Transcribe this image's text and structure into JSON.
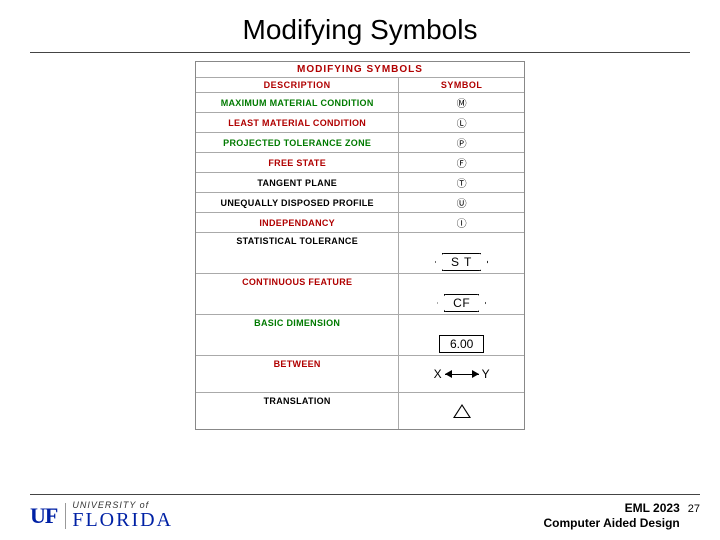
{
  "title": "Modifying Symbols",
  "table": {
    "caption": "MODIFYING SYMBOLS",
    "headers": {
      "desc": "DESCRIPTION",
      "sym": "SYMBOL"
    },
    "rows": [
      {
        "desc": "MAXIMUM MATERIAL CONDITION",
        "color": "green",
        "symbol": "Ⓜ"
      },
      {
        "desc": "LEAST MATERIAL CONDITION",
        "color": "red",
        "symbol": "Ⓛ"
      },
      {
        "desc": "PROJECTED TOLERANCE ZONE",
        "color": "green",
        "symbol": "Ⓟ"
      },
      {
        "desc": "FREE STATE",
        "color": "red",
        "symbol": "Ⓕ"
      },
      {
        "desc": "TANGENT PLANE",
        "color": "",
        "symbol": "Ⓣ"
      },
      {
        "desc": "UNEQUALLY DISPOSED PROFILE",
        "color": "",
        "symbol": "Ⓤ"
      },
      {
        "desc": "INDEPENDANCY",
        "color": "red",
        "symbol": "Ⓘ"
      },
      {
        "desc": "STATISTICAL TOLERANCE",
        "color": "",
        "symbol_text": "S T"
      },
      {
        "desc": "CONTINUOUS FEATURE",
        "color": "red",
        "symbol_text": "CF"
      },
      {
        "desc": "BASIC DIMENSION",
        "color": "green",
        "symbol_text": "6.00"
      },
      {
        "desc": "BETWEEN",
        "color": "red",
        "between": {
          "a": "X",
          "b": "Y"
        }
      },
      {
        "desc": "TRANSLATION",
        "color": "",
        "triangle": true
      }
    ]
  },
  "footer": {
    "uf_mark": "UF",
    "uf_top": "UNIVERSITY of",
    "uf_bot": "FLORIDA",
    "course_code": "EML 2023",
    "course_name": "Computer Aided Design",
    "page": "27"
  }
}
